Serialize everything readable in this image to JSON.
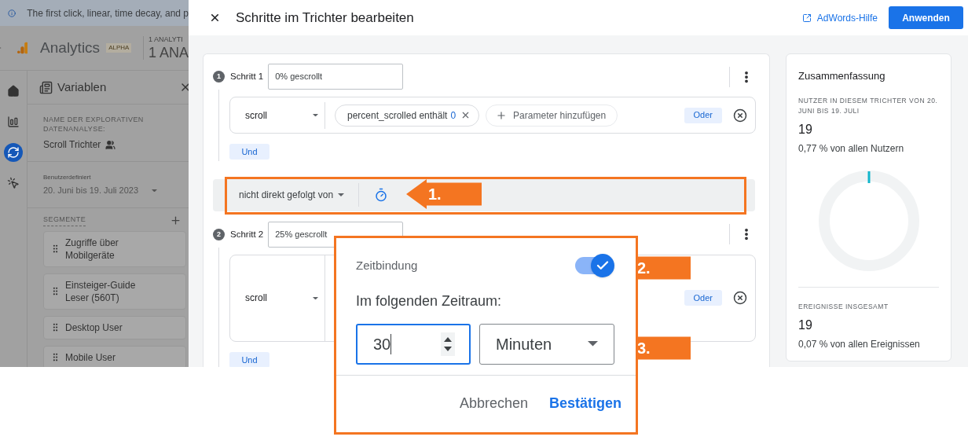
{
  "banner": {
    "text": "The first click, linear, time decay, and p"
  },
  "app_header": {
    "product": "Analytics",
    "badge": "ALPHA",
    "property_label": "1 ANALYTI",
    "property_name": "1 ANA"
  },
  "nav_rail": [
    {
      "kind": "home",
      "selected": false
    },
    {
      "kind": "reports",
      "selected": false
    },
    {
      "kind": "explore",
      "selected": true
    },
    {
      "kind": "advertising",
      "selected": false
    }
  ],
  "variables_panel": {
    "title": "Variablen",
    "name_label": "NAME DER EXPLORATIVEN DATENANALYSE:",
    "name": "Scroll Trichter",
    "date_label": "Benutzerdefiniert",
    "date_range": "20. Juni bis 19. Juli 2023",
    "segments_label": "SEGMENTE",
    "segments": [
      "Zugriffe über Mobilgeräte",
      "Einsteiger-Guide Leser (560T)",
      "Desktop User",
      "Mobile User"
    ]
  },
  "dialog": {
    "title": "Schritte im Trichter bearbeiten",
    "help_link": "AdWords-Hilfe",
    "apply_button": "Anwenden"
  },
  "steps": [
    {
      "number": "1",
      "label": "Schritt 1",
      "name": "0% gescrollt",
      "event": "scroll",
      "conditions": [
        {
          "text": "percent_scrolled enthält",
          "value": "0"
        }
      ],
      "add_parameter": "Parameter hinzufügen",
      "or_button": "Oder",
      "and_button": "Und"
    },
    {
      "number": "2",
      "label": "Schritt 2",
      "name": "25% gescrollt",
      "event": "scroll",
      "or_button": "Oder",
      "and_button": "Und"
    }
  ],
  "connector": {
    "text": "nicht direkt gefolgt von"
  },
  "summary": {
    "title": "Zusammenfassung",
    "users_label": "NUTZER IN DIESEM TRICHTER VON 20. JUNI BIS 19. JULI",
    "users_value": "19",
    "users_share": "0,77 % von allen Nutzern",
    "events_label": "EREIGNISSE INSGESAMT",
    "events_value": "19",
    "events_share": "0,07 % von allen Ereignissen"
  },
  "time_popup": {
    "title": "Zeitbindung",
    "on": true,
    "period_label": "Im folgenden Zeitraum:",
    "value": "30",
    "unit": "Minuten",
    "cancel_button": "Abbrechen",
    "confirm_button": "Bestätigen"
  },
  "annotations": [
    {
      "label": "1."
    },
    {
      "label": "2."
    },
    {
      "label": "3."
    }
  ]
}
